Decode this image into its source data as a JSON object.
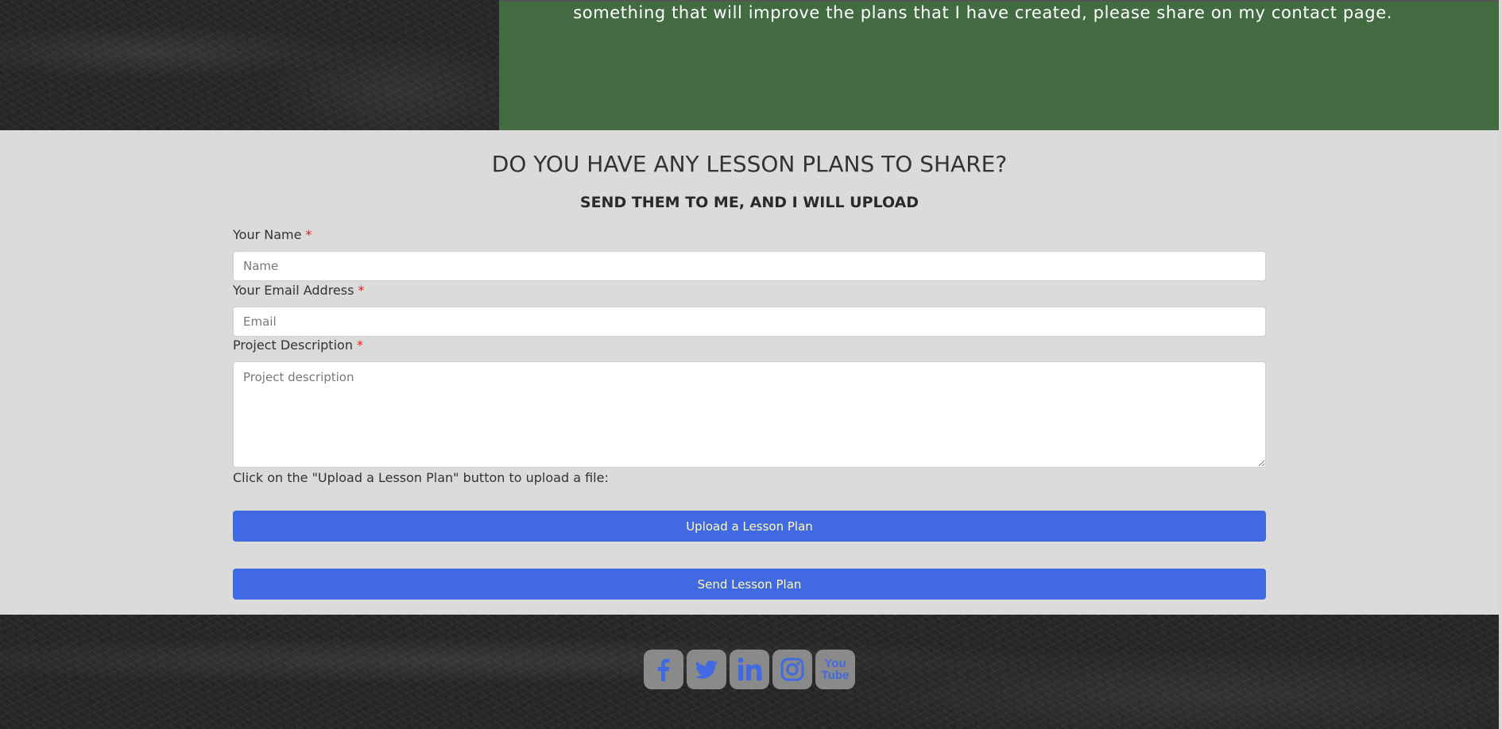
{
  "banner": {
    "text": "something that will improve the plans that I have created, please share on my contact page."
  },
  "form": {
    "heading": "DO YOU HAVE ANY LESSON PLANS TO SHARE?",
    "subheading": "SEND THEM TO ME, AND I WILL UPLOAD",
    "required_mark": "*",
    "name_label": "Your Name",
    "name_placeholder": "Name",
    "name_value": "",
    "email_label": "Your Email Address",
    "email_placeholder": "Email",
    "email_value": "",
    "description_label": "Project Description",
    "description_placeholder": "Project description",
    "description_value": "",
    "upload_hint": "Click on the \"Upload a Lesson Plan\" button to upload a file:",
    "upload_button": "Upload a Lesson Plan",
    "send_button": "Send Lesson Plan"
  },
  "footer": {
    "social": [
      {
        "icon": "facebook-icon"
      },
      {
        "icon": "twitter-icon"
      },
      {
        "icon": "linkedin-icon"
      },
      {
        "icon": "instagram-icon"
      },
      {
        "icon": "youtube-icon",
        "text_top": "You",
        "text_bottom": "Tube"
      }
    ]
  },
  "colors": {
    "green_panel": "#426b42",
    "form_background": "#dcdbdc",
    "button": "#4169e1",
    "button_text": "#fffbb0",
    "icon_tile": "#8a8a8a",
    "icon_glyph": "#4169e1",
    "required": "#dd2222"
  }
}
